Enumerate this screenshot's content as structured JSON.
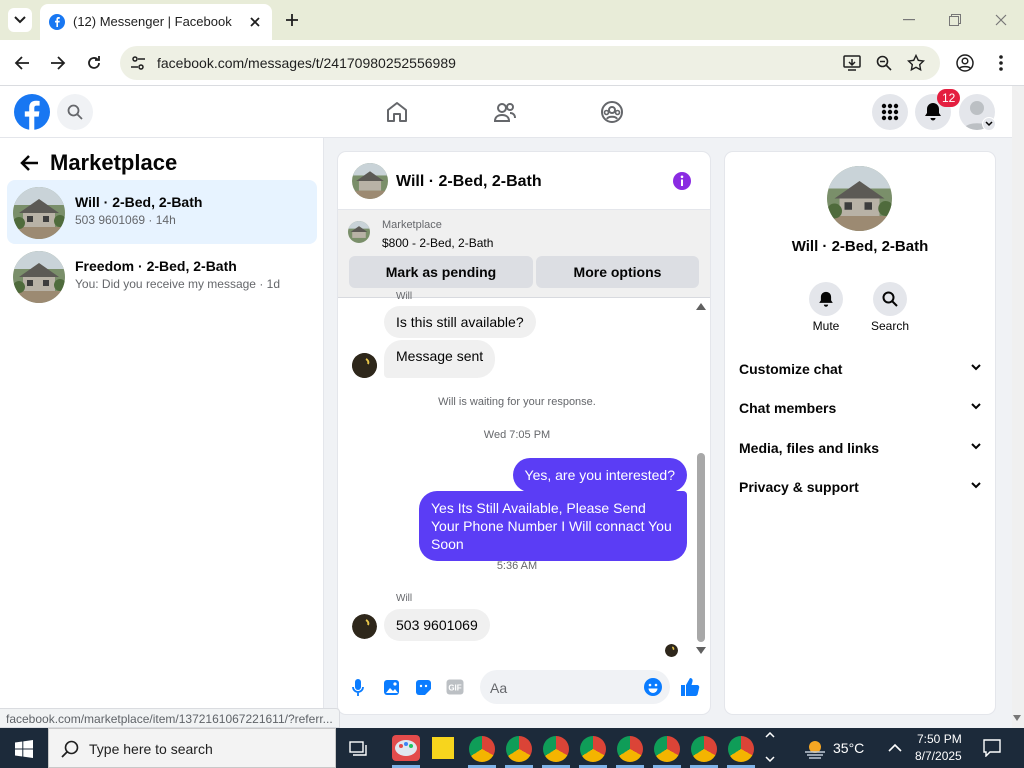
{
  "browser": {
    "tabTitle": "(12) Messenger | Facebook",
    "url": "facebook.com/messages/t/24170980252556989",
    "statusUrl": "facebook.com/marketplace/item/1372161067221611/?referr..."
  },
  "fb": {
    "notificationCount": "12",
    "brandColor": "#1877f2"
  },
  "sidebar": {
    "title": "Marketplace",
    "conversations": [
      {
        "name": "Will · 2-Bed, 2-Bath",
        "subtitle": "503 9601069 · 14h",
        "selected": true
      },
      {
        "name": "Freedom · 2-Bed, 2-Bath",
        "subtitle": "You: Did you receive my message · 1d",
        "selected": false
      }
    ]
  },
  "chat": {
    "title": "Will · 2-Bed, 2-Bath",
    "listing": {
      "source": "Marketplace",
      "price": "$800 - 2-Bed, 2-Bath"
    },
    "markPending": "Mark as pending",
    "moreOptions": "More options",
    "topSender": "Will",
    "msg1": "Is this still available?",
    "msg2": "Message sent",
    "waitingNotice": "Will is waiting for your response.",
    "time1": "Wed 7:05 PM",
    "out1": "Yes, are you interested?",
    "out2": "Yes Its Still Available, Please Send Your Phone Number I Will connact You Soon",
    "time2": "5:36 AM",
    "sender": "Will",
    "msg3": "503 9601069",
    "inputPlaceholder": "Aa",
    "accentColor": "#5b3df5"
  },
  "info": {
    "name": "Will · 2-Bed, 2-Bath",
    "muteLabel": "Mute",
    "searchLabel": "Search",
    "sections": [
      "Customize chat",
      "Chat members",
      "Media, files and links",
      "Privacy & support"
    ]
  },
  "taskbar": {
    "searchPlaceholder": "Type here to search",
    "temperature": "35°C",
    "time": "7:50 PM",
    "date": "8/7/2025"
  }
}
